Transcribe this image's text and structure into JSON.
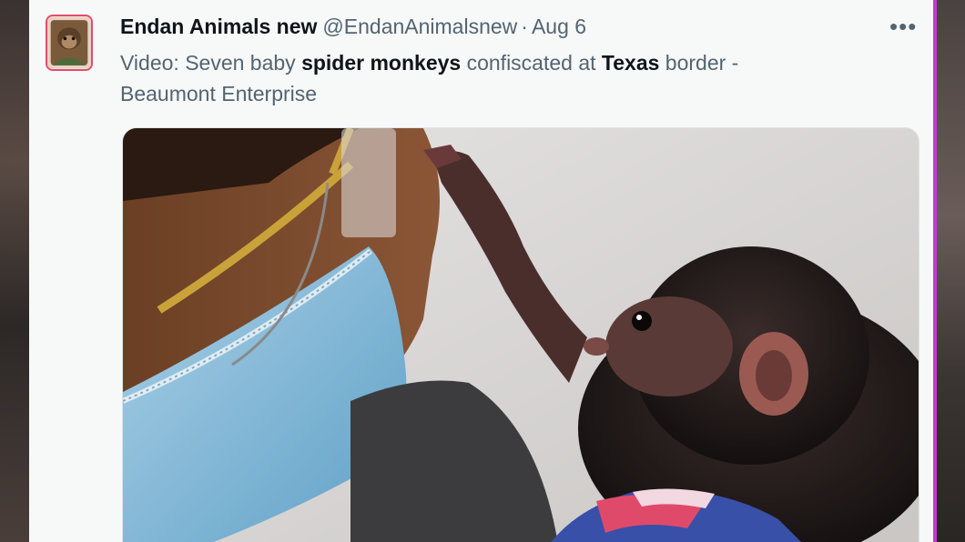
{
  "tweet": {
    "display_name": "Endan Animals new",
    "handle": "@EndanAnimalsnew",
    "separator": "·",
    "date": "Aug 6",
    "more_glyph": "•••",
    "text_parts": {
      "p1": "Video: Seven baby ",
      "b1": "spider monkeys",
      "p2": " confiscated at ",
      "b2": "Texas",
      "p3": " border -",
      "p4": "Beaumont Enterprise"
    }
  },
  "colors": {
    "card_bg": "#f7f9f9",
    "name": "#0f1419",
    "secondary": "#536471",
    "accent": "#c23ad0"
  },
  "icons": {
    "avatar": "profile-photo",
    "more": "more-options-icon"
  }
}
